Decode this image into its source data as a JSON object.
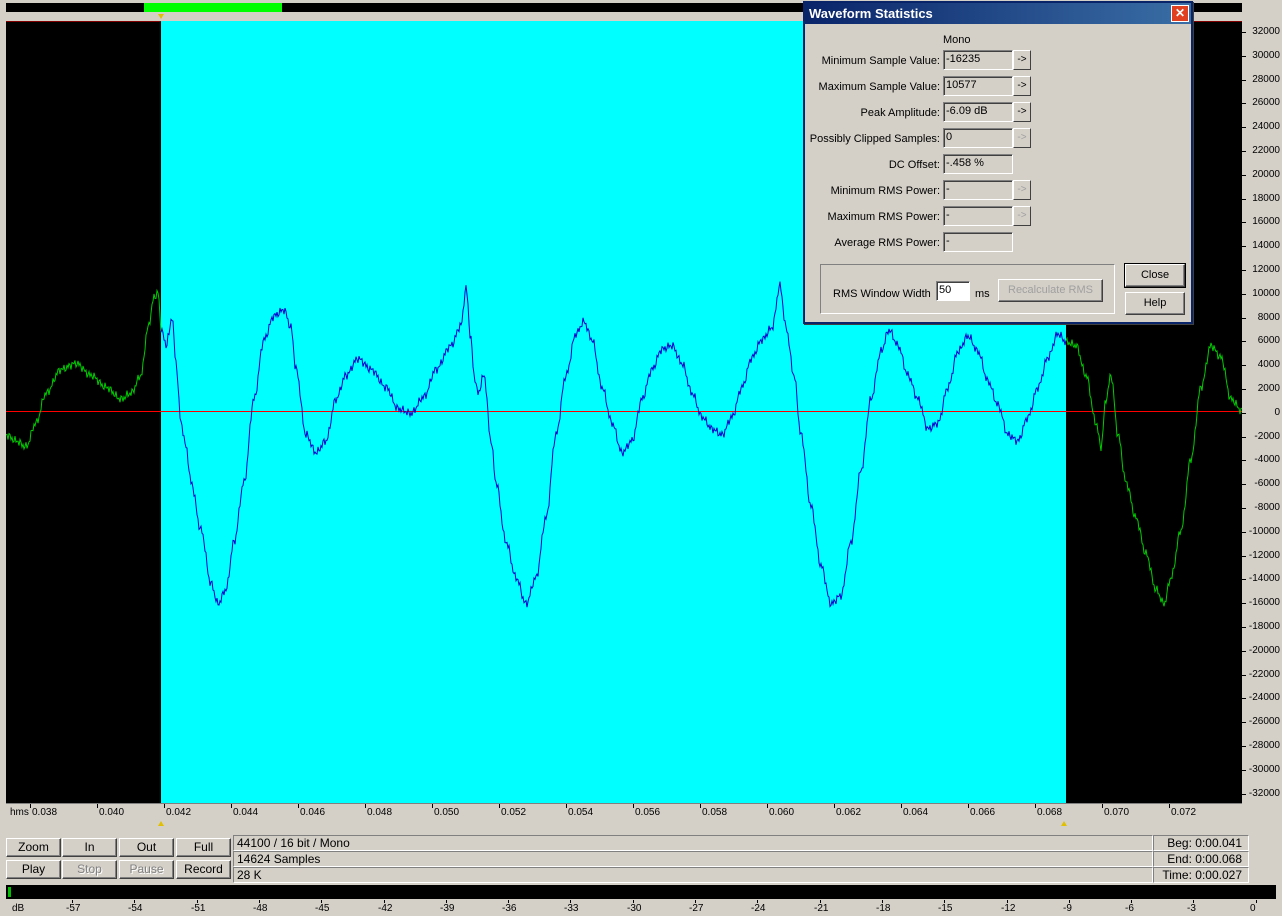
{
  "colors": {
    "background": "#000000",
    "selection": "#00ffff",
    "waveform_outside": "#00cc00",
    "waveform_selected": "#0000cc",
    "zero_line": "#ff0000",
    "overview_thumb": "#00ff00"
  },
  "amplitude_ruler": {
    "labels": [
      "32000",
      "30000",
      "28000",
      "26000",
      "24000",
      "22000",
      "20000",
      "18000",
      "16000",
      "14000",
      "12000",
      "10000",
      "8000",
      "6000",
      "4000",
      "2000",
      "0",
      "-2000",
      "-4000",
      "-6000",
      "-8000",
      "-10000",
      "-12000",
      "-14000",
      "-16000",
      "-18000",
      "-20000",
      "-22000",
      "-24000",
      "-26000",
      "-28000",
      "-30000",
      "-32000"
    ]
  },
  "time_ruler": {
    "prefix": "hms",
    "labels": [
      "0.038",
      "0.040",
      "0.042",
      "0.044",
      "0.046",
      "0.048",
      "0.050",
      "0.052",
      "0.054",
      "0.056",
      "0.058",
      "0.060",
      "0.062",
      "0.064",
      "0.066",
      "0.068",
      "0.070",
      "0.072"
    ]
  },
  "transport": {
    "zoom": "Zoom",
    "in": "In",
    "out": "Out",
    "full": "Full",
    "play": "Play",
    "stop": "Stop",
    "pause": "Pause",
    "record": "Record"
  },
  "info": {
    "format": "44100 / 16 bit / Mono",
    "samples": "14624 Samples",
    "size": "28 K",
    "beg_label": "Beg:",
    "beg_value": "0:00.041",
    "end_label": "End:",
    "end_value": "0:00.068",
    "time_label": "Time:",
    "time_value": "0:00.027"
  },
  "meter": {
    "unit": "dB",
    "labels": [
      "-57",
      "-54",
      "-51",
      "-48",
      "-45",
      "-42",
      "-39",
      "-36",
      "-33",
      "-30",
      "-27",
      "-24",
      "-21",
      "-18",
      "-15",
      "-12",
      "-9",
      "-6",
      "-3",
      "0"
    ]
  },
  "dialog": {
    "title": "Waveform Statistics",
    "channel": "Mono",
    "rows": [
      {
        "label": "Minimum Sample Value:",
        "value": "-16235",
        "arrow": "->",
        "arrow_enabled": true
      },
      {
        "label": "Maximum Sample Value:",
        "value": "10577",
        "arrow": "->",
        "arrow_enabled": true
      },
      {
        "label": "Peak Amplitude:",
        "value": "-6.09 dB",
        "arrow": "->",
        "arrow_enabled": true
      },
      {
        "label": "Possibly Clipped Samples:",
        "value": "0",
        "arrow": "->",
        "arrow_enabled": false
      },
      {
        "label": "DC Offset:",
        "value": "-.458 %"
      },
      {
        "label": "Minimum RMS Power:",
        "value": "-",
        "arrow": "->",
        "arrow_enabled": false
      },
      {
        "label": "Maximum RMS Power:",
        "value": "-",
        "arrow": "->",
        "arrow_enabled": false
      },
      {
        "label": "Average RMS Power:",
        "value": "-"
      }
    ],
    "rms_window_label": "RMS Window Width",
    "rms_window_value": "50",
    "rms_unit": "ms",
    "recalc": "Recalculate RMS",
    "close": "Close",
    "help": "Help"
  }
}
